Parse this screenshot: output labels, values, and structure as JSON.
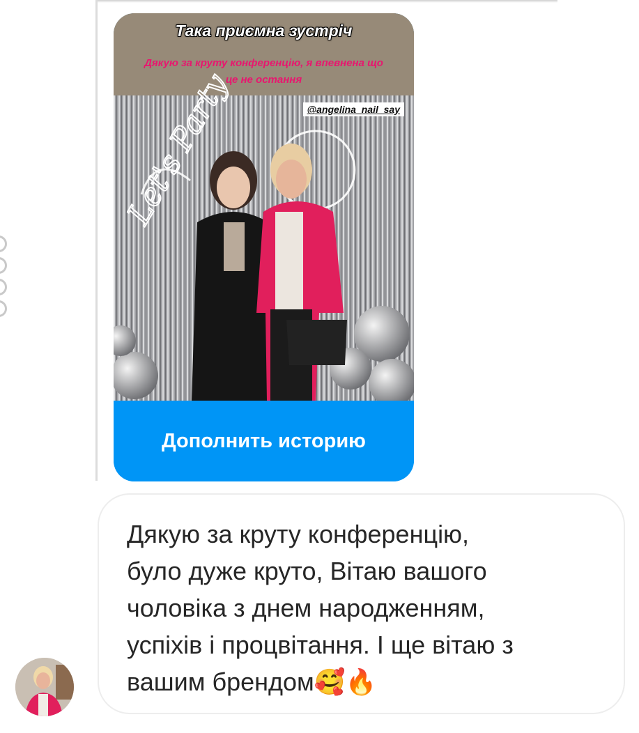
{
  "story": {
    "overlay_title": "Така приємна зустріч",
    "overlay_text": "Дякую за круту конференцію, я впевнена що це не остання",
    "mention": "@angelina_nail_say",
    "photo_sign_text": "Let's Party",
    "cta_label": "Дополнить историю"
  },
  "message": {
    "text": "Дякую за круту конференцію,\nбуло дуже круто, Вітаю вашого\nчоловіка з днем народженням,\nуспіхів і процвітання.  І ще вітаю з\nвашим брендом🥰🔥"
  },
  "icons": {
    "avatar": "user-avatar",
    "side_menu": "more-dots-icon"
  },
  "colors": {
    "cta_blue": "#0095f6",
    "overlay_pink": "#e8176f",
    "bubble_border": "#ededed",
    "text": "#262626"
  }
}
